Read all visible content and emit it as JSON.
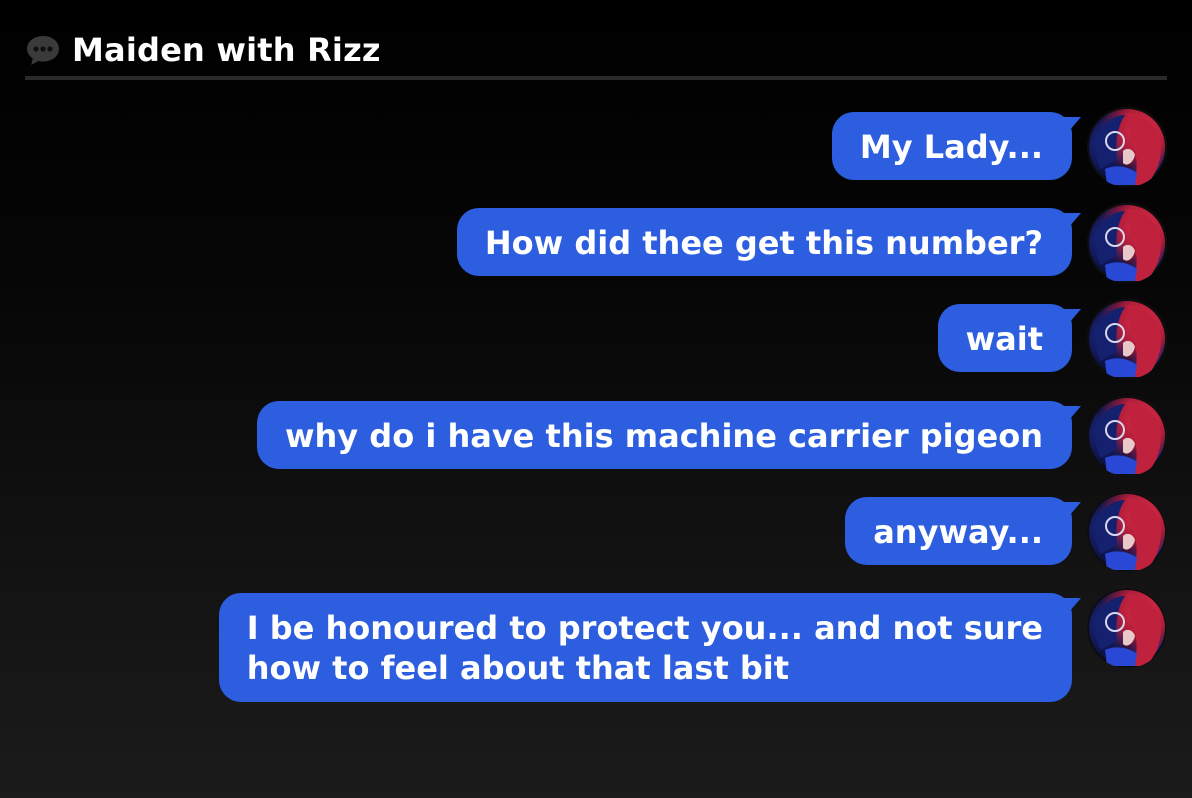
{
  "header": {
    "icon": "speech-bubble-icon",
    "title": "Maiden with Rizz"
  },
  "colors": {
    "bubble": "#2d5ee0",
    "divider": "#2a2a2a",
    "background_top": "#000000",
    "background_bottom": "#1b1b1b"
  },
  "messages": [
    {
      "text": "My Lady..."
    },
    {
      "text": "How did thee get this number?"
    },
    {
      "text": "wait"
    },
    {
      "text": "why do i have this machine carrier pigeon"
    },
    {
      "text": "anyway..."
    },
    {
      "text": "I be honoured to protect you... and not sure\nhow to feel about that last bit"
    }
  ]
}
